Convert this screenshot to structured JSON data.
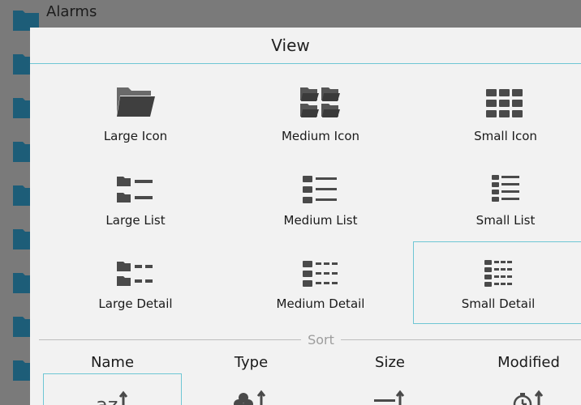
{
  "background": {
    "first_item_title": "Alarms"
  },
  "dialog": {
    "title": "View",
    "view_options": [
      {
        "label": "Large Icon",
        "icon": "large-folder-icon"
      },
      {
        "label": "Medium Icon",
        "icon": "medium-folders-icon"
      },
      {
        "label": "Small Icon",
        "icon": "small-folders-icon"
      },
      {
        "label": "Large List",
        "icon": "large-list-icon"
      },
      {
        "label": "Medium List",
        "icon": "medium-list-icon"
      },
      {
        "label": "Small List",
        "icon": "small-list-icon"
      },
      {
        "label": "Large Detail",
        "icon": "large-detail-icon"
      },
      {
        "label": "Medium Detail",
        "icon": "medium-detail-icon"
      },
      {
        "label": "Small Detail",
        "icon": "small-detail-icon",
        "selected": true
      }
    ],
    "sort_section_label": "Sort",
    "sort_options": [
      {
        "label": "Name",
        "icon": "az-ascending-icon",
        "selected": true
      },
      {
        "label": "Type",
        "icon": "type-ascending-icon"
      },
      {
        "label": "Size",
        "icon": "size-ascending-icon"
      },
      {
        "label": "Modified",
        "icon": "clock-ascending-icon"
      }
    ]
  },
  "colors": {
    "accent": "#6ec6d4",
    "folder_bg": "#1d5d78",
    "icon_gray": "#4a4a4a"
  }
}
